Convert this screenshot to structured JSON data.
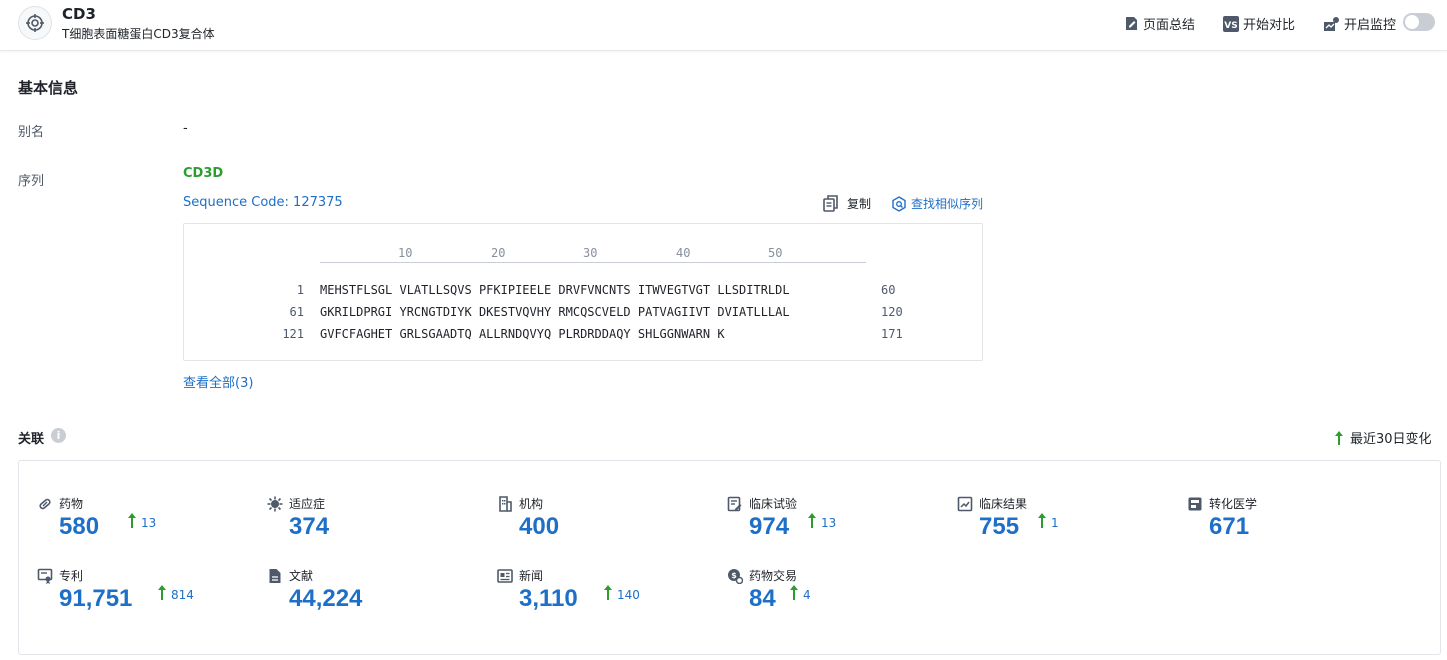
{
  "header": {
    "title": "CD3",
    "subtitle": "T细胞表面糖蛋白CD3复合体",
    "actions": {
      "summary": "页面总结",
      "compare": "开始对比",
      "monitor": "开启监控"
    }
  },
  "basic_info": {
    "section_title": "基本信息",
    "alias_label": "别名",
    "alias_value": "-",
    "sequence_label": "序列",
    "gene_name": "CD3D",
    "sequence_code": "Sequence Code: 127375",
    "copy_label": "复制",
    "find_similar_label": "查找相似序列",
    "ruler": [
      "10",
      "20",
      "30",
      "40",
      "50"
    ],
    "sequence_lines": [
      {
        "start": "1",
        "seq": "MEHSTFLSGL VLATLLSQVS PFKIPIEELE DRVFVNCNTS ITWVEGTVGT LLSDITRLDL",
        "end": "60"
      },
      {
        "start": "61",
        "seq": "GKRILDPRGI YRCNGTDIYK DKESTVQVHY RMCQSCVELD PATVAGIIVT DVIATLLLAL",
        "end": "120"
      },
      {
        "start": "121",
        "seq": "GVFCFAGHET GRLSGAADTQ ALLRNDQVYQ PLRDRDDAQY SHLGGNWARN K",
        "end": "171"
      }
    ],
    "view_all": "查看全部(3)"
  },
  "related": {
    "section_title": "关联",
    "info_icon": "i",
    "recent_change": "最近30日变化",
    "colors": {
      "accent": "#1e6fc7",
      "up": "#2e9d30",
      "icon": "#4e5969"
    },
    "stats": [
      {
        "label": "药物",
        "value": "580",
        "delta": "13",
        "icon": "pill-icon"
      },
      {
        "label": "适应症",
        "value": "374",
        "delta": "",
        "icon": "virus-icon"
      },
      {
        "label": "机构",
        "value": "400",
        "delta": "",
        "icon": "building-icon"
      },
      {
        "label": "临床试验",
        "value": "974",
        "delta": "13",
        "icon": "clinical-trial-icon"
      },
      {
        "label": "临床结果",
        "value": "755",
        "delta": "1",
        "icon": "clinical-result-icon"
      },
      {
        "label": "转化医学",
        "value": "671",
        "delta": "",
        "icon": "translational-icon"
      },
      {
        "label": "专利",
        "value": "91,751",
        "delta": "814",
        "icon": "patent-icon"
      },
      {
        "label": "文献",
        "value": "44,224",
        "delta": "",
        "icon": "document-icon"
      },
      {
        "label": "新闻",
        "value": "3,110",
        "delta": "140",
        "icon": "news-icon"
      },
      {
        "label": "药物交易",
        "value": "84",
        "delta": "4",
        "icon": "deal-icon"
      }
    ]
  }
}
